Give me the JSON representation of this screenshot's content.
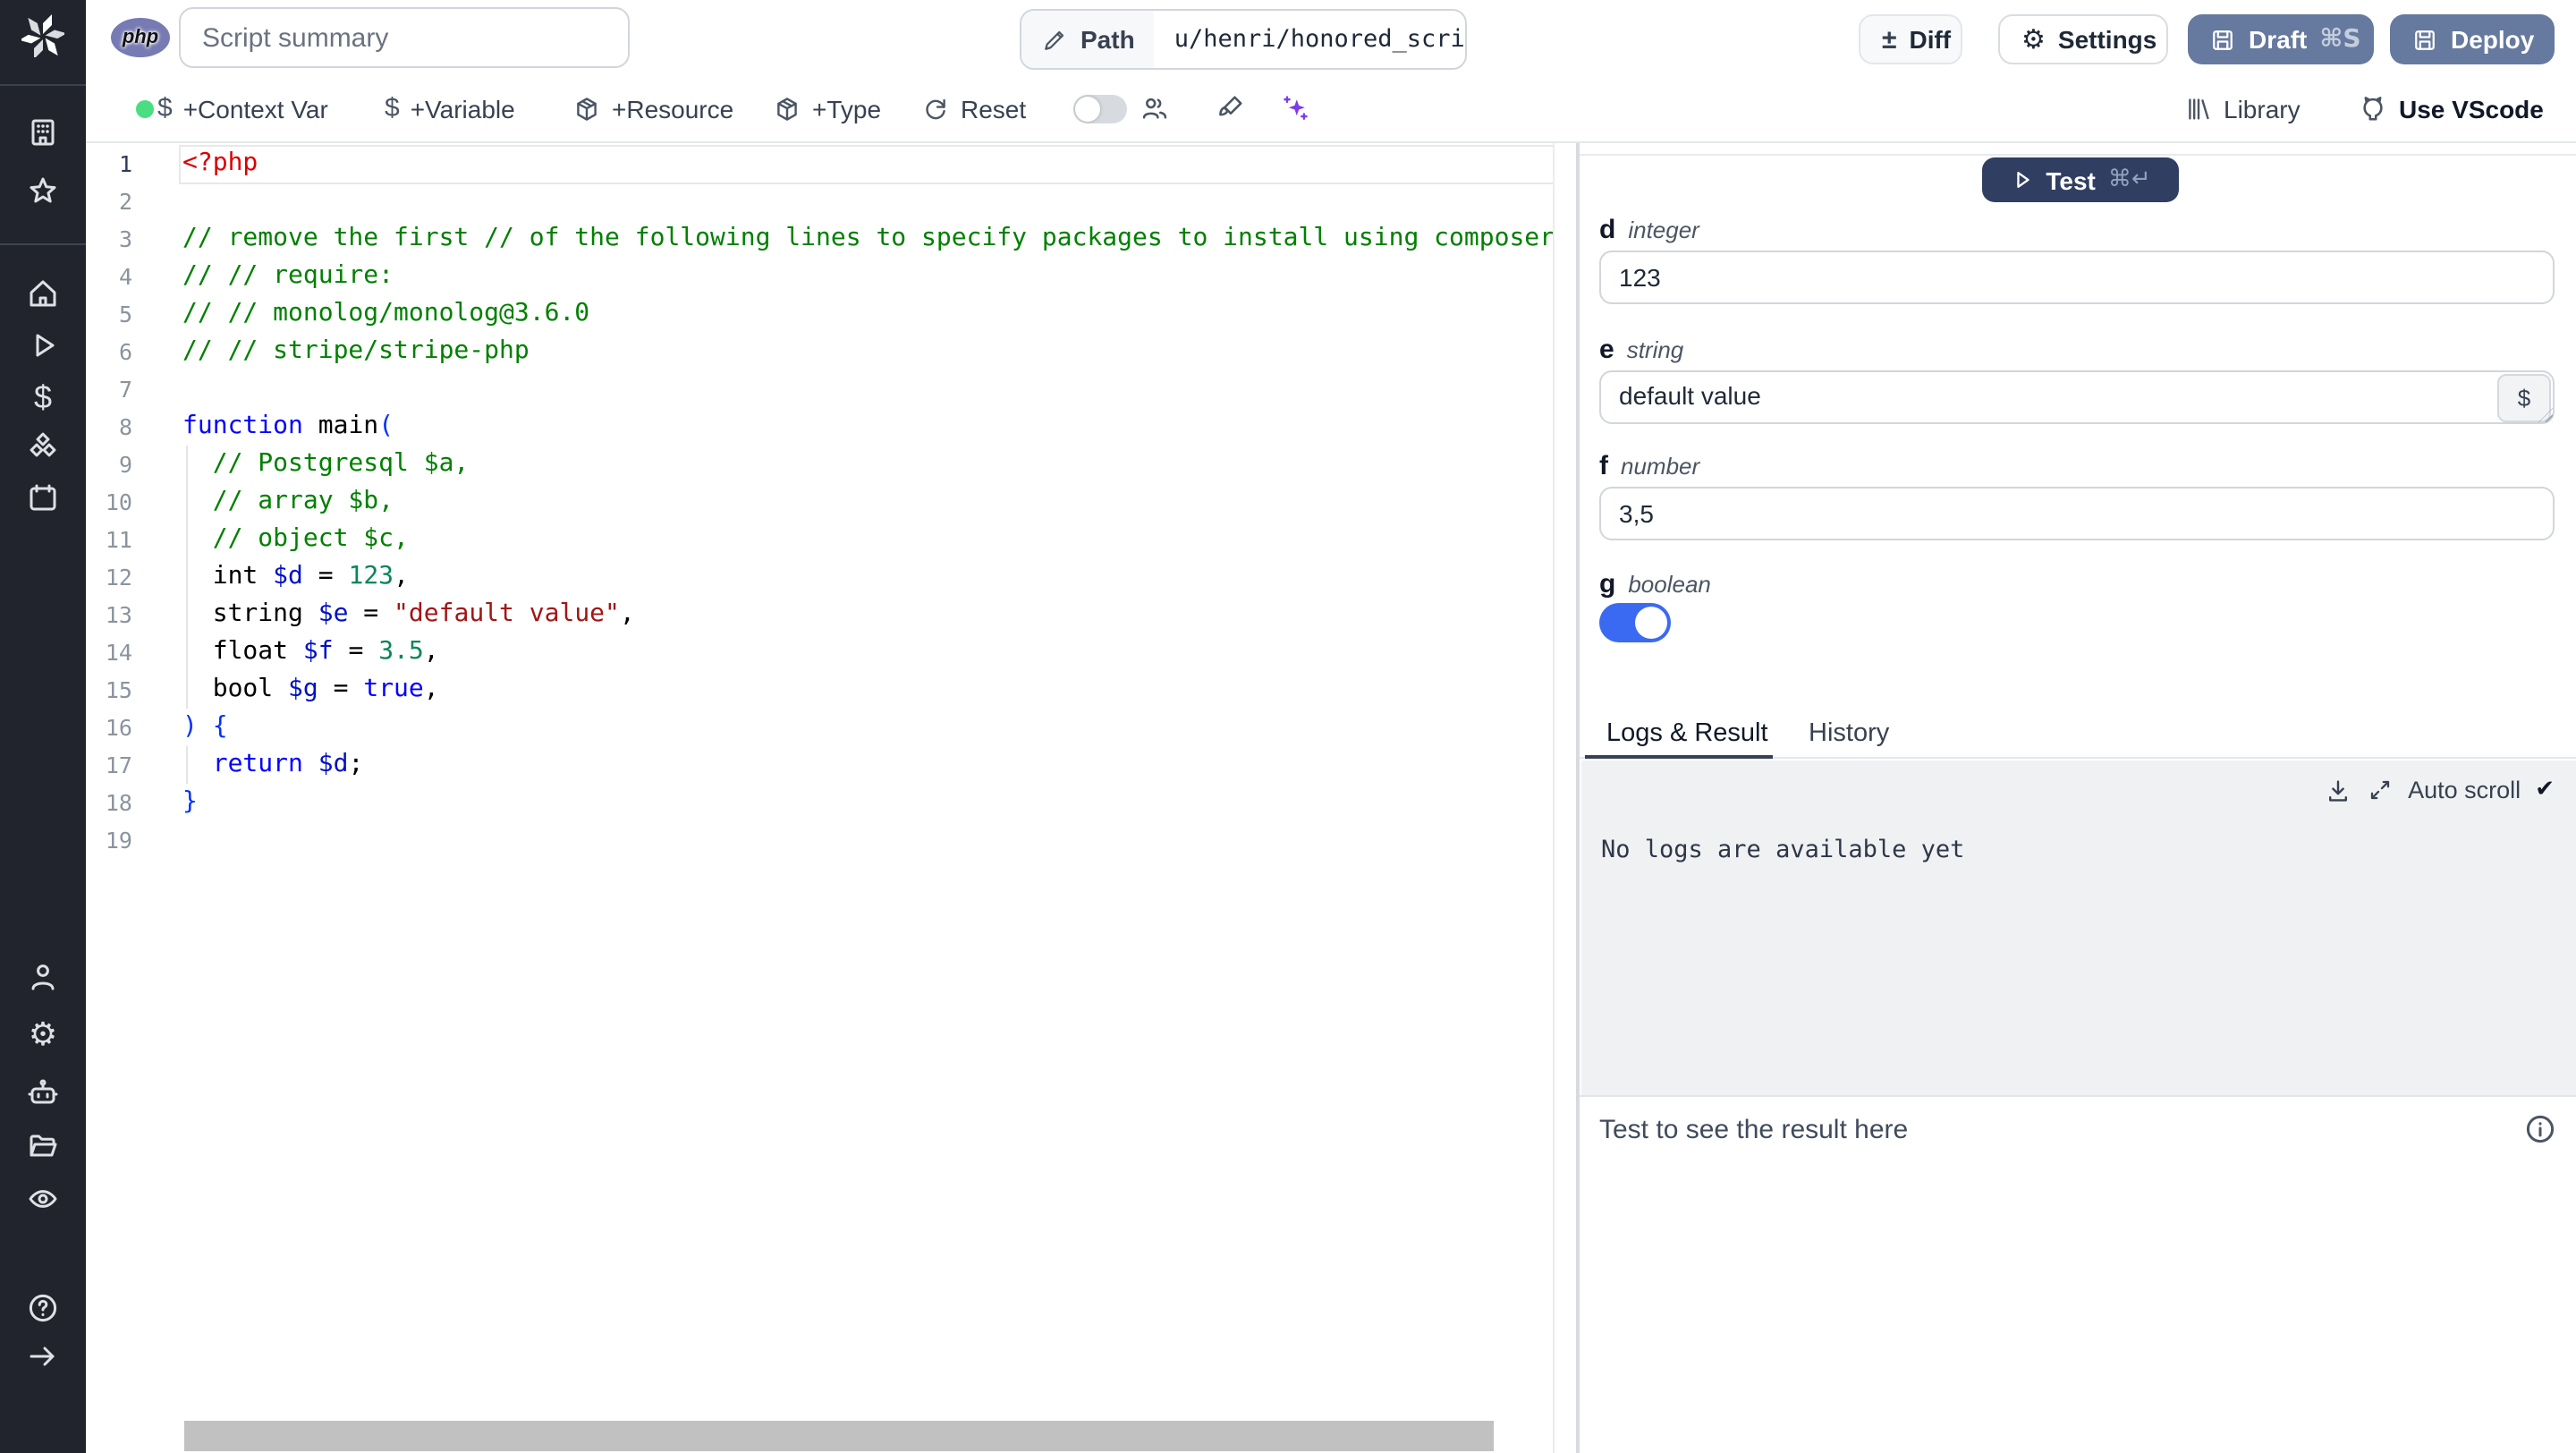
{
  "topbar": {
    "language_badge": "php",
    "summary_value": "Script summary",
    "path_label": "Path",
    "path_value": "u/henri/honored_script",
    "diff_label": "Diff",
    "settings_label": "Settings",
    "draft_label": "Draft",
    "draft_shortcut": "⌘S",
    "deploy_label": "Deploy"
  },
  "toolbar": {
    "context_var": "+Context Var",
    "variable": "+Variable",
    "resource": "+Resource",
    "type": "+Type",
    "reset": "Reset",
    "library": "Library",
    "use_vscode": "Use VScode"
  },
  "editor": {
    "language": "php",
    "token_colors": {
      "meta": "#dd0000",
      "com": "#008000",
      "kw": "#0000ff",
      "var": "#0010c5",
      "num": "#098658",
      "str": "#a31515",
      "br": "#0431fa",
      "plain": "#000000"
    },
    "lines": [
      [
        [
          "<?php",
          "meta"
        ]
      ],
      [],
      [
        [
          "// remove the first // of the following lines to specify packages to install using composer",
          "com"
        ]
      ],
      [
        [
          "// // require:",
          "com"
        ]
      ],
      [
        [
          "// // monolog/monolog@3.6.0",
          "com"
        ]
      ],
      [
        [
          "// // stripe/stripe-php",
          "com"
        ]
      ],
      [],
      [
        [
          "function",
          "kw"
        ],
        [
          " main",
          "plain"
        ],
        [
          "(",
          "br"
        ]
      ],
      [
        [
          "  // Postgresql $a,",
          "com"
        ]
      ],
      [
        [
          "  // array $b,",
          "com"
        ]
      ],
      [
        [
          "  // object $c,",
          "com"
        ]
      ],
      [
        [
          "  int ",
          "plain"
        ],
        [
          "$d",
          "var"
        ],
        [
          " = ",
          "plain"
        ],
        [
          "123",
          "num"
        ],
        [
          ",",
          "plain"
        ]
      ],
      [
        [
          "  string ",
          "plain"
        ],
        [
          "$e",
          "var"
        ],
        [
          " = ",
          "plain"
        ],
        [
          "\"default value\"",
          "str"
        ],
        [
          ",",
          "plain"
        ]
      ],
      [
        [
          "  float ",
          "plain"
        ],
        [
          "$f",
          "var"
        ],
        [
          " = ",
          "plain"
        ],
        [
          "3.5",
          "num"
        ],
        [
          ",",
          "plain"
        ]
      ],
      [
        [
          "  bool ",
          "plain"
        ],
        [
          "$g",
          "var"
        ],
        [
          " = ",
          "plain"
        ],
        [
          "true",
          "kw"
        ],
        [
          ",",
          "plain"
        ]
      ],
      [
        [
          ") {",
          "br"
        ]
      ],
      [
        [
          "  return",
          "kw"
        ],
        [
          " ",
          "plain"
        ],
        [
          "$d",
          "var"
        ],
        [
          ";",
          "plain"
        ]
      ],
      [
        [
          "}",
          "br"
        ]
      ],
      []
    ]
  },
  "runner": {
    "test_label": "Test",
    "test_shortcut": "⌘↵",
    "fields": [
      {
        "name": "d",
        "type": "integer",
        "value": "123"
      },
      {
        "name": "e",
        "type": "string",
        "value": "default value"
      },
      {
        "name": "f",
        "type": "number",
        "value": "3,5"
      },
      {
        "name": "g",
        "type": "boolean",
        "value": "true"
      }
    ],
    "tabs": [
      "Logs & Result",
      "History"
    ],
    "active_tab": "Logs & Result",
    "auto_scroll_label": "Auto scroll",
    "no_logs_text": "No logs are available yet",
    "result_placeholder": "Test to see the result here"
  },
  "colors": {
    "sidebar_bg": "#21242c",
    "draft_deploy_button": "#66799e",
    "test_button": "#303e61",
    "toggle_on": "#3b6af2",
    "status_dot": "#4ade80",
    "sparkles": "#7c3aed",
    "logs_panel_bg": "#f0f1f3"
  },
  "icons": [
    "windmill-logo",
    "php-badge",
    "pencil-icon",
    "plus-minus-icon",
    "gear-icon",
    "save-icon",
    "dollar-icon",
    "package-icon",
    "reset-icon",
    "users-icon",
    "brush-icon",
    "sparkles-icon",
    "library-icon",
    "github-icon",
    "play-icon",
    "building-icon",
    "star-icon",
    "home-icon",
    "cubes-icon",
    "calendar-icon",
    "user-icon",
    "robot-icon",
    "folder-icon",
    "eye-icon",
    "help-icon",
    "arrow-right-icon",
    "download-icon",
    "expand-icon",
    "check-icon",
    "info-icon"
  ]
}
